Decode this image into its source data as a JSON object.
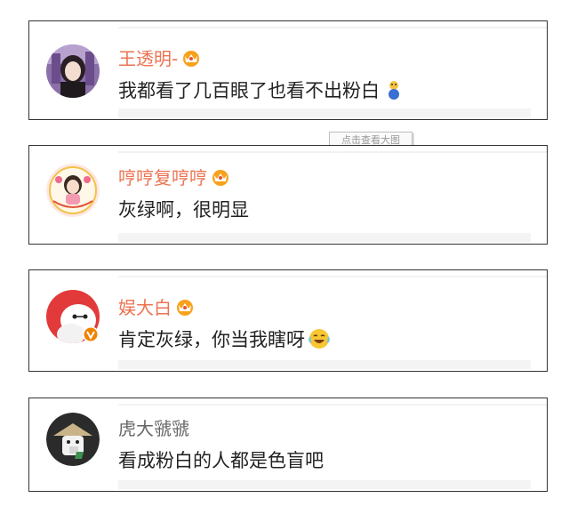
{
  "comments": [
    {
      "user": "王透明-",
      "text": "我都看了几百眼了也看不出粉白",
      "crown_badge": true,
      "trailing_emoji": "doge-figure-icon",
      "avatar_icon": "user-avatar-photo-icon"
    },
    {
      "user": "哼哼复哼哼",
      "text": "灰绿啊，很明显",
      "crown_badge": true,
      "trailing_emoji": "",
      "avatar_icon": "user-avatar-birthday-icon"
    },
    {
      "user": "娱大白",
      "text": "肯定灰绿，你当我瞎呀",
      "crown_badge": true,
      "trailing_emoji": "laughing-crying-icon",
      "avatar_icon": "user-avatar-baymax-verified-icon"
    },
    {
      "user": "虎大虢虢",
      "text": "看成粉白的人都是色盲吧",
      "crown_badge": false,
      "trailing_emoji": "",
      "avatar_icon": "user-avatar-cartoon-icon"
    }
  ],
  "tooltip": {
    "label": "点击查看大图"
  },
  "colors": {
    "username": "#eb7350",
    "username_plain": "#666666",
    "text": "#222222",
    "border": "#333333"
  }
}
